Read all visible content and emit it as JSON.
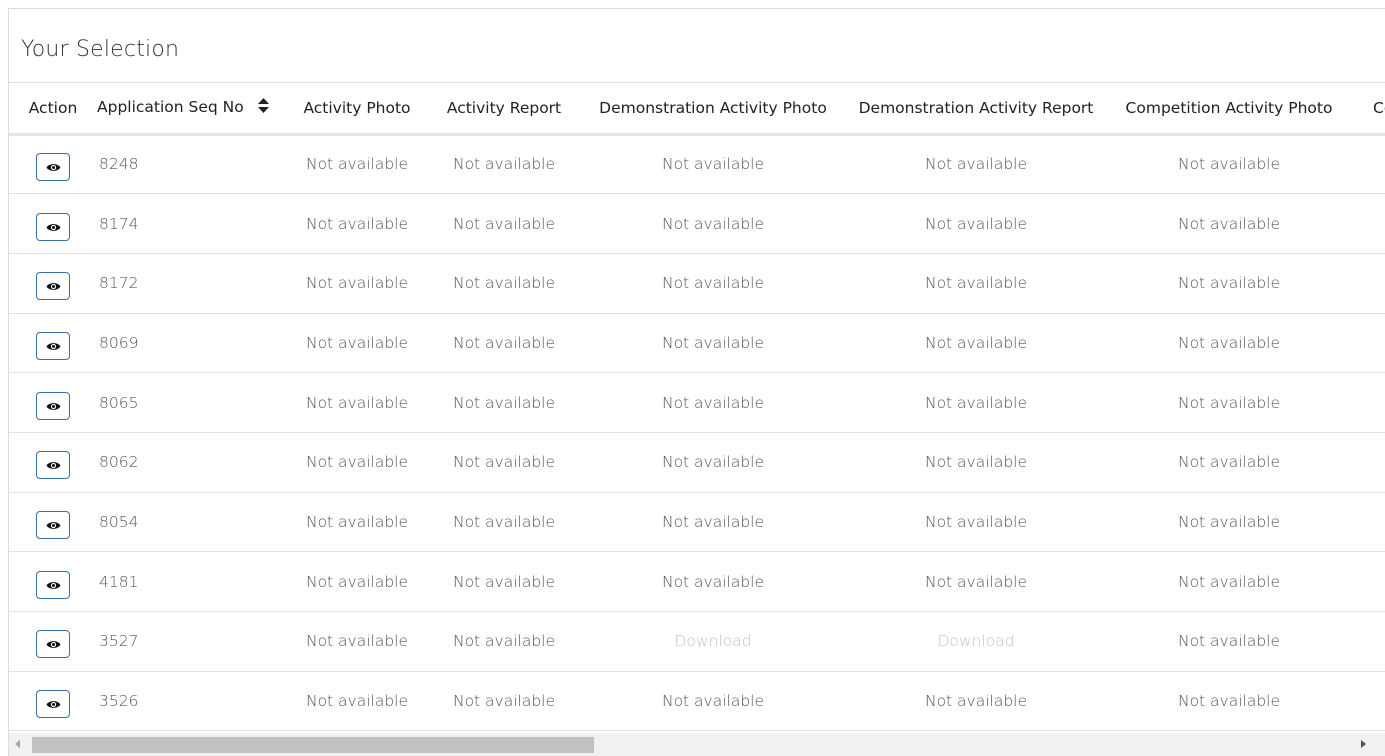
{
  "panel": {
    "title": "Your Selection"
  },
  "table": {
    "headers": {
      "action": "Action",
      "seq": "Application Seq No",
      "activity_photo": "Activity Photo",
      "activity_report": "Activity Report",
      "demo_photo": "Demonstration Activity Photo",
      "demo_report": "Demonstration Activity Report",
      "comp_photo": "Competition Activity Photo",
      "comp_report_partial": "Com"
    },
    "rows": [
      {
        "seq": "8248",
        "activity_photo": "Not available",
        "activity_report": "Not available",
        "demo_photo": "Not available",
        "demo_report": "Not available",
        "comp_photo": "Not available"
      },
      {
        "seq": "8174",
        "activity_photo": "Not available",
        "activity_report": "Not available",
        "demo_photo": "Not available",
        "demo_report": "Not available",
        "comp_photo": "Not available"
      },
      {
        "seq": "8172",
        "activity_photo": "Not available",
        "activity_report": "Not available",
        "demo_photo": "Not available",
        "demo_report": "Not available",
        "comp_photo": "Not available"
      },
      {
        "seq": "8069",
        "activity_photo": "Not available",
        "activity_report": "Not available",
        "demo_photo": "Not available",
        "demo_report": "Not available",
        "comp_photo": "Not available"
      },
      {
        "seq": "8065",
        "activity_photo": "Not available",
        "activity_report": "Not available",
        "demo_photo": "Not available",
        "demo_report": "Not available",
        "comp_photo": "Not available"
      },
      {
        "seq": "8062",
        "activity_photo": "Not available",
        "activity_report": "Not available",
        "demo_photo": "Not available",
        "demo_report": "Not available",
        "comp_photo": "Not available"
      },
      {
        "seq": "8054",
        "activity_photo": "Not available",
        "activity_report": "Not available",
        "demo_photo": "Not available",
        "demo_report": "Not available",
        "comp_photo": "Not available"
      },
      {
        "seq": "4181",
        "activity_photo": "Not available",
        "activity_report": "Not available",
        "demo_photo": "Not available",
        "demo_report": "Not available",
        "comp_photo": "Not available"
      },
      {
        "seq": "3527",
        "activity_photo": "Not available",
        "activity_report": "Not available",
        "demo_photo": "Download",
        "demo_report": "Download",
        "comp_photo": "Not available"
      },
      {
        "seq": "3526",
        "activity_photo": "Not available",
        "activity_report": "Not available",
        "demo_photo": "Not available",
        "demo_report": "Not available",
        "comp_photo": "Not available"
      }
    ],
    "icons": {
      "action": "eye-icon",
      "sort": "sort-icon"
    },
    "colors": {
      "button_border": "#3a6ea5",
      "download_text": "#c3c3c3"
    }
  }
}
